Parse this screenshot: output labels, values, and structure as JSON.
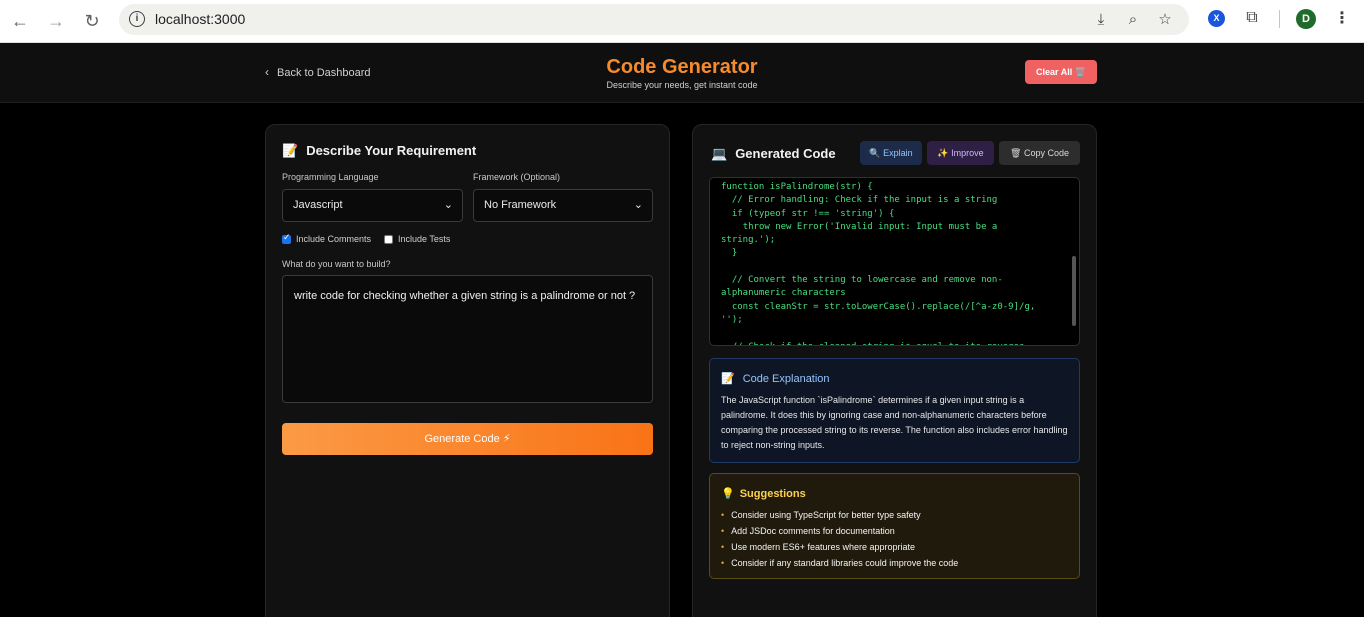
{
  "browser": {
    "url": "localhost:3000",
    "extension_badge": "X",
    "profile_initial": "D"
  },
  "header": {
    "back_label": "Back to Dashboard",
    "title": "Code Generator",
    "subtitle": "Describe your needs, get instant code",
    "clear_label": "Clear All 🗑️"
  },
  "left": {
    "title_icon": "📝",
    "title": "Describe Your Requirement",
    "language_label": "Programming Language",
    "language_value": "Javascript",
    "framework_label": "Framework (Optional)",
    "framework_value": "No Framework",
    "include_comments_label": "Include Comments",
    "include_comments_checked": true,
    "include_tests_label": "Include Tests",
    "include_tests_checked": false,
    "prompt_label": "What do you want to build?",
    "prompt_value": "write  code for checking whether a given string is a palindrome or not ?",
    "generate_label": "Generate Code ⚡"
  },
  "right": {
    "title_icon": "💻",
    "title": "Generated Code",
    "explain_label": "🔍 Explain",
    "improve_label": "✨ Improve",
    "copy_label": "🗑 Copy Code",
    "code": "function isPalindrome(str) {\n  // Error handling: Check if the input is a string\n  if (typeof str !== 'string') {\n    throw new Error('Invalid input: Input must be a string.');\n  }\n\n  // Convert the string to lowercase and remove non-alphanumeric characters\n  const cleanStr = str.toLowerCase().replace(/[^a-z0-9]/g, '');\n\n  // Check if the cleaned string is equal to its reverse\n  return cleanStr === cleanStr.split('').reverse().join('');\n}",
    "explanation_icon": "📝",
    "explanation_title": "Code Explanation",
    "explanation_text": "The JavaScript function `isPalindrome` determines if a given input string is a palindrome. It does this by ignoring case and non-alphanumeric characters before comparing the processed string to its reverse. The function also includes error handling to reject non-string inputs.",
    "suggestions_icon": "💡",
    "suggestions_title": "Suggestions",
    "suggestions": [
      "Consider using TypeScript for better type safety",
      "Add JSDoc comments for documentation",
      "Use modern ES6+ features where appropriate",
      "Consider if any standard libraries could improve the code"
    ]
  }
}
